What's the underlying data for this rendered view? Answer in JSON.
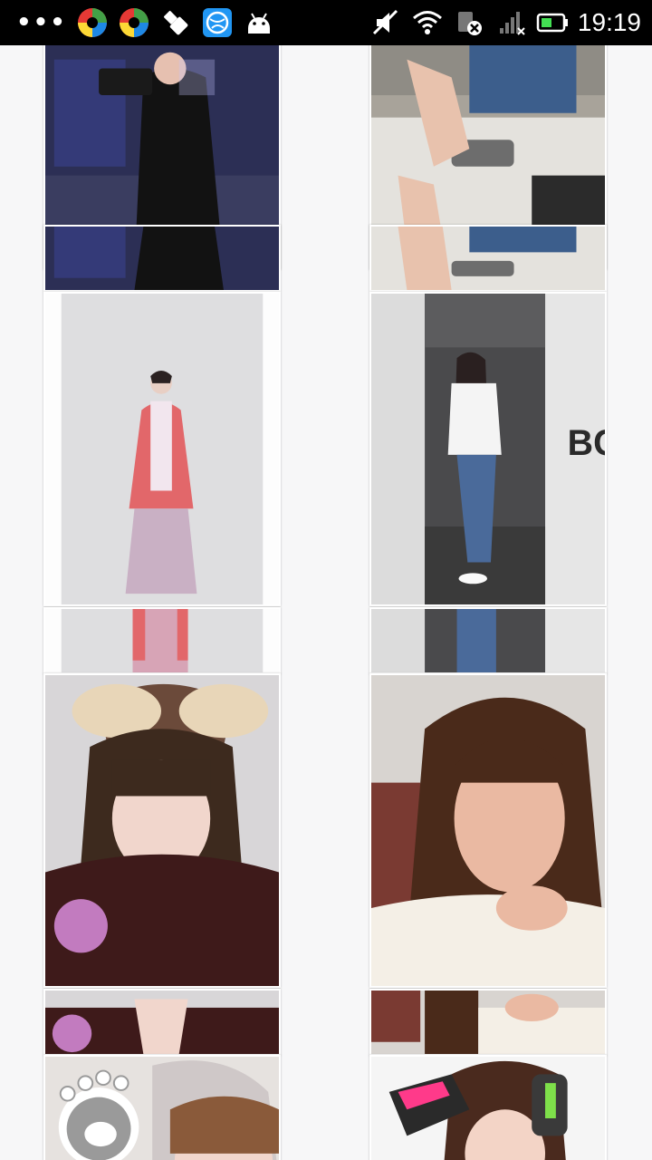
{
  "status_bar": {
    "overflow_dots": "•••",
    "time": "19:19",
    "left_icons": [
      "app-swirl-icon",
      "app-swirl-icon",
      "usb-debug-icon",
      "browser-globe-icon",
      "android-icon"
    ],
    "right_icons": [
      "mute-icon",
      "wifi-icon",
      "data-off-icon",
      "signal-icon",
      "battery-icon"
    ]
  },
  "feed": {
    "columns": 2,
    "photos": [
      {
        "id": "photo-1",
        "subject": "girl-with-camera"
      },
      {
        "id": "photo-2",
        "subject": "girl-on-truck-tailgate"
      },
      {
        "id": "photo-3",
        "subject": "girl-in-pink-hanfu"
      },
      {
        "id": "photo-4",
        "subject": "girl-in-parking-garage"
      },
      {
        "id": "photo-5",
        "subject": "girl-with-bow-headband"
      },
      {
        "id": "photo-6",
        "subject": "girl-making-face"
      },
      {
        "id": "photo-7",
        "subject": "girl-with-paw-sticker"
      },
      {
        "id": "photo-8",
        "subject": "girl-cosplay-dva"
      }
    ]
  }
}
